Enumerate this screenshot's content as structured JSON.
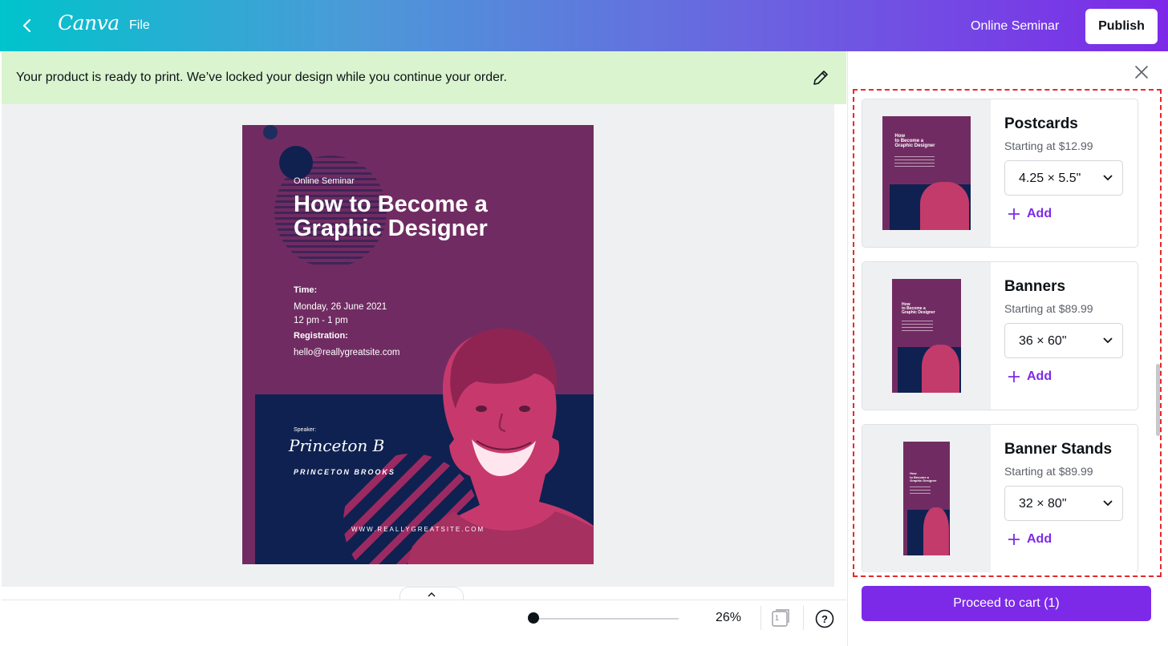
{
  "header": {
    "app_name": "Canva",
    "file_label": "File",
    "design_title": "Online Seminar",
    "publish_label": "Publish"
  },
  "notice": {
    "text": "Your product is ready to print. We’ve locked your design while you continue your order."
  },
  "poster": {
    "subtitle": "Online Seminar",
    "title": "How to Become a Graphic Designer",
    "time_label": "Time:",
    "date": "Monday, 26 June 2021",
    "hours": "12 pm - 1 pm",
    "registration_label": "Registration:",
    "email": "hello@reallygreatsite.com",
    "speaker_label": "Speaker:",
    "signature": "Princeton B",
    "speaker_name": "PRINCETON BROOKS",
    "website": "WWW.REALLYGREATSITE.COM"
  },
  "footer": {
    "zoom_level": 0.26,
    "zoom_label": "26%",
    "page_number": "1",
    "help_label": "?"
  },
  "print_options": [
    {
      "title": "Postcards",
      "price": "Starting at $12.99",
      "size": "4.25 × 5.5\"",
      "add_label": "Add",
      "thumb": "postcard"
    },
    {
      "title": "Banners",
      "price": "Starting at $89.99",
      "size": "36 × 60\"",
      "add_label": "Add",
      "thumb": "banner"
    },
    {
      "title": "Banner Stands",
      "price": "Starting at $89.99",
      "size": "32 × 80\"",
      "add_label": "Add",
      "thumb": "banner-stand"
    }
  ],
  "cart": {
    "label": "Proceed to cart (1)"
  },
  "colors": {
    "accent": "#7d2ae8",
    "header_gradient_start": "#00c4cc",
    "header_gradient_end": "#7d2ae8",
    "notice_bg": "#daf4cf",
    "poster_magenta": "#702c62",
    "poster_navy": "#0f2150",
    "highlight_dash": "#e6282b"
  },
  "icons": {
    "back": "chevron-left-icon",
    "edit": "pencil-icon",
    "close": "close-icon",
    "dropdown": "chevron-down-icon",
    "add": "plus-icon",
    "pages": "page-icon",
    "help": "help-icon"
  }
}
